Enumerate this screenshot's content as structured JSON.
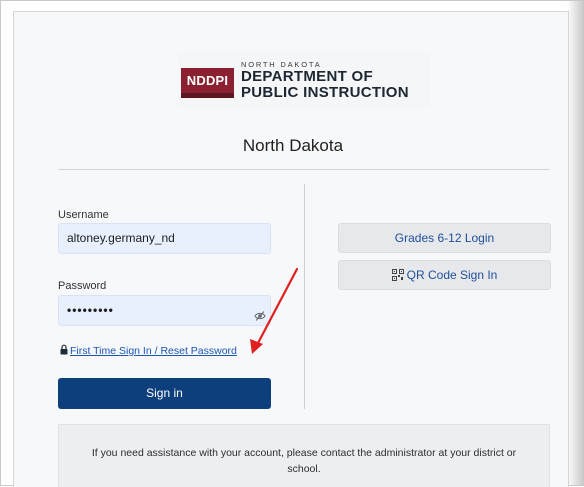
{
  "logo": {
    "badge": "NDDPI",
    "small_text": "NORTH DAKOTA",
    "line1": "DEPARTMENT OF",
    "line2": "PUBLIC INSTRUCTION",
    "brand_color": "#8b2130"
  },
  "title": "North Dakota",
  "form": {
    "username_label": "Username",
    "username_value": "altoney.germany_nd",
    "password_label": "Password",
    "password_value": "•••••••••",
    "reset_link": "First Time Sign In / Reset Password",
    "signin_label": "Sign in",
    "signin_color": "#0e3f7d"
  },
  "alt_login": {
    "grades_label": "Grades 6-12 Login",
    "qr_label": "QR Code Sign In"
  },
  "help": {
    "text": "If you need assistance with your account, please contact the administrator at your district or school."
  },
  "icons": {
    "eye": "eye-icon",
    "lock": "lock-icon",
    "qr": "qr-code-icon",
    "arrow": "annotation-arrow"
  },
  "annotation_color": "#e02020"
}
